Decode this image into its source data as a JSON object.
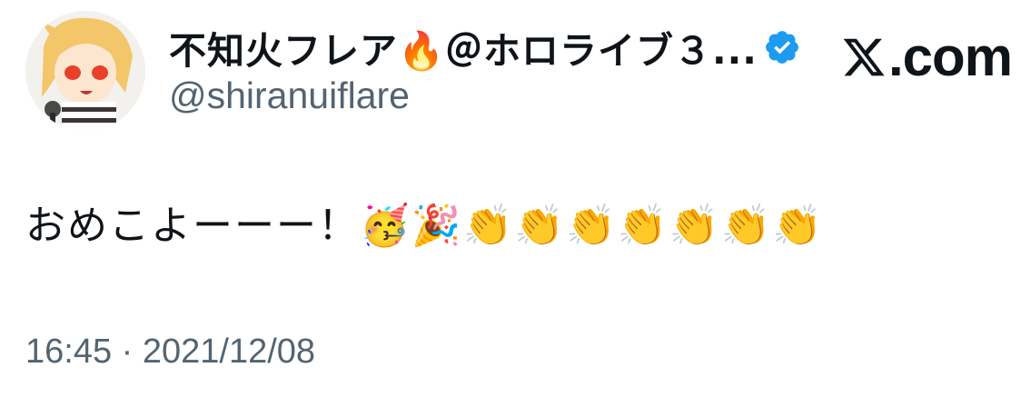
{
  "author": {
    "display_name": "不知火フレア🔥＠ホロライブ３...",
    "handle": "@shiranuiflare",
    "verified": true,
    "avatar_icon": "anime-avatar-icon"
  },
  "brand": {
    "label": ".com",
    "icon": "x-logo-icon"
  },
  "tweet": {
    "text": "おめこよーーー！🥳🎉👏👏👏👏👏👏👏"
  },
  "timestamp": "16:45 · 2021/12/08",
  "colors": {
    "text": "#0f1419",
    "secondary": "#536471",
    "verified": "#1d9bf0"
  }
}
